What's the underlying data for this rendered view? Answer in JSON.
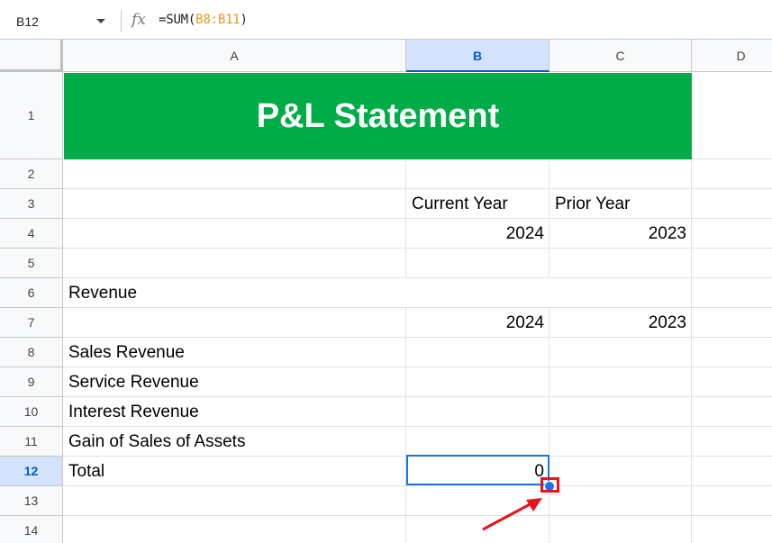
{
  "formula_bar": {
    "name_box": "B12",
    "fx_label": "fx",
    "formula_prefix": "=SUM(",
    "formula_ref": "B8:B11",
    "formula_suffix": ")"
  },
  "columns": [
    "A",
    "B",
    "C",
    "D"
  ],
  "selected_column": "B",
  "rows": [
    "1",
    "2",
    "3",
    "4",
    "5",
    "6",
    "7",
    "8",
    "9",
    "10",
    "11",
    "12",
    "13",
    "14"
  ],
  "selected_row": "12",
  "sheet": {
    "title": "P&L Statement",
    "b3": "Current Year",
    "c3": "Prior Year",
    "b4": "2024",
    "c4": "2023",
    "a6": "Revenue",
    "b7": "2024",
    "c7": "2023",
    "a8": "Sales Revenue",
    "a9": "Service Revenue",
    "a10": "Interest Revenue",
    "a11": "Gain of Sales of Assets",
    "a12": "Total",
    "b12": "0"
  },
  "colors": {
    "title_fill": "#00ac47",
    "selection": "#1a73e8",
    "highlight": "#e8141c"
  },
  "annotation": {
    "target": "fill-handle",
    "icon": "arrow-icon"
  }
}
